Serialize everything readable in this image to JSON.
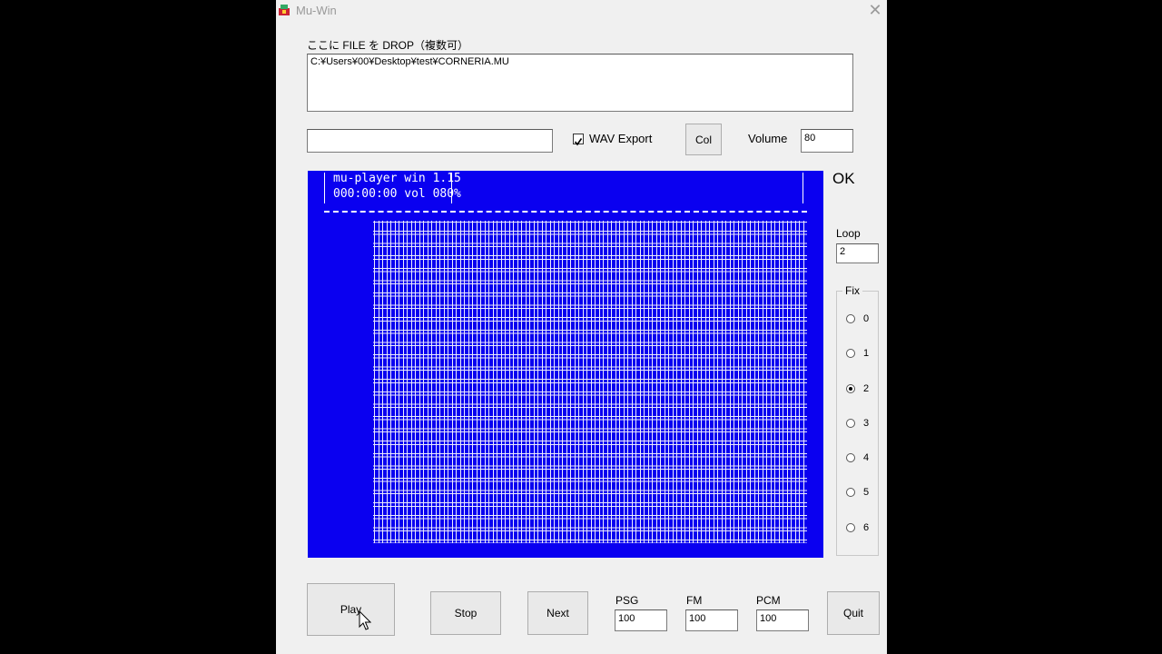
{
  "window": {
    "title": "Mu-Win",
    "close_glyph": "✕"
  },
  "drop": {
    "label": "ここに FILE を DROP（複数可）",
    "files": "C:¥Users¥00¥Desktop¥test¥CORNERIA.MU"
  },
  "controls": {
    "text_field_value": "",
    "wav_export_label": "WAV Export",
    "wav_export_checked": true,
    "col_label": "Col",
    "volume_label": "Volume",
    "volume_value": "80",
    "status": "OK",
    "loop_label": "Loop",
    "loop_value": "2"
  },
  "console": {
    "line1": "mu-player win 1.15",
    "line2": "000:00:00 vol 080%",
    "bg_color": "#0a00f0"
  },
  "fix": {
    "label": "Fix",
    "options": [
      "0",
      "1",
      "2",
      "3",
      "4",
      "5",
      "6"
    ],
    "selected": "2"
  },
  "bottom": {
    "play_label": "Play",
    "stop_label": "Stop",
    "next_label": "Next",
    "psg_label": "PSG",
    "psg_value": "100",
    "fm_label": "FM",
    "fm_value": "100",
    "pcm_label": "PCM",
    "pcm_value": "100",
    "quit_label": "Quit"
  }
}
